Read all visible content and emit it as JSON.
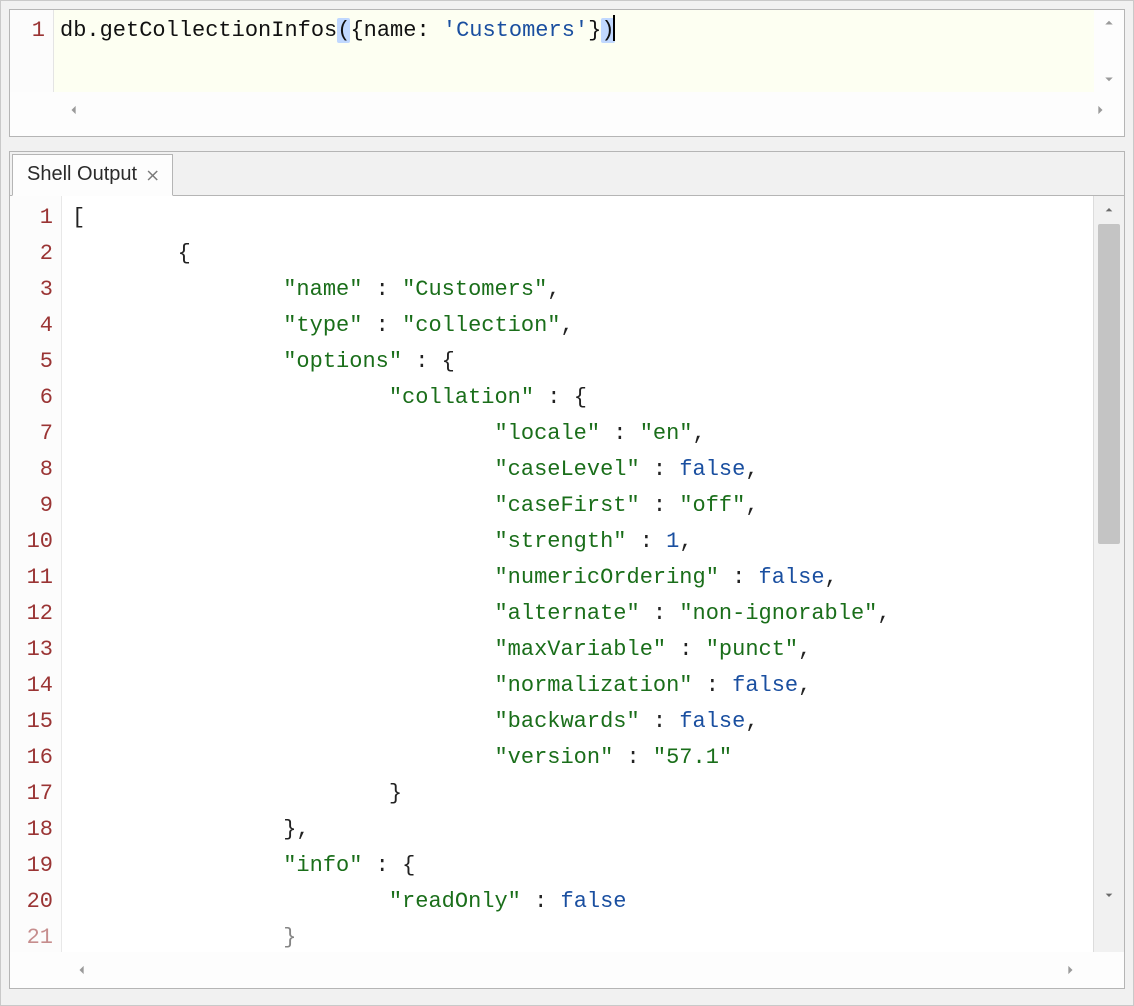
{
  "input": {
    "line_number": "1",
    "tokens": {
      "obj": "db",
      "dot": ".",
      "func": "getCollectionInfos",
      "paren_open": "(",
      "brace_open": "{",
      "key": "name",
      "colon": ": ",
      "str": "'Customers'",
      "brace_close": "}",
      "paren_close": ")"
    }
  },
  "tabs": {
    "shell_output": "Shell Output",
    "close_glyph": "⨯"
  },
  "output": {
    "line_numbers": [
      "1",
      "2",
      "3",
      "4",
      "5",
      "6",
      "7",
      "8",
      "9",
      "10",
      "11",
      "12",
      "13",
      "14",
      "15",
      "16",
      "17",
      "18",
      "19",
      "20",
      "21"
    ],
    "lines": [
      {
        "indent": 0,
        "raw": "[",
        "parts": [
          {
            "t": "[",
            "cls": "j-punc"
          }
        ]
      },
      {
        "indent": 1,
        "raw": "{",
        "parts": [
          {
            "t": "{",
            "cls": "j-punc"
          }
        ]
      },
      {
        "indent": 2,
        "raw": "\"name\" : \"Customers\",",
        "parts": [
          {
            "t": "\"name\"",
            "cls": "j-key"
          },
          {
            "t": " : ",
            "cls": "j-punc"
          },
          {
            "t": "\"Customers\"",
            "cls": "j-str"
          },
          {
            "t": ",",
            "cls": "j-punc"
          }
        ]
      },
      {
        "indent": 2,
        "raw": "\"type\" : \"collection\",",
        "parts": [
          {
            "t": "\"type\"",
            "cls": "j-key"
          },
          {
            "t": " : ",
            "cls": "j-punc"
          },
          {
            "t": "\"collection\"",
            "cls": "j-str"
          },
          {
            "t": ",",
            "cls": "j-punc"
          }
        ]
      },
      {
        "indent": 2,
        "raw": "\"options\" : {",
        "parts": [
          {
            "t": "\"options\"",
            "cls": "j-key"
          },
          {
            "t": " : ",
            "cls": "j-punc"
          },
          {
            "t": "{",
            "cls": "j-punc"
          }
        ]
      },
      {
        "indent": 3,
        "raw": "\"collation\" : {",
        "parts": [
          {
            "t": "\"collation\"",
            "cls": "j-key"
          },
          {
            "t": " : ",
            "cls": "j-punc"
          },
          {
            "t": "{",
            "cls": "j-punc"
          }
        ]
      },
      {
        "indent": 4,
        "raw": "\"locale\" : \"en\",",
        "parts": [
          {
            "t": "\"locale\"",
            "cls": "j-key"
          },
          {
            "t": " : ",
            "cls": "j-punc"
          },
          {
            "t": "\"en\"",
            "cls": "j-str"
          },
          {
            "t": ",",
            "cls": "j-punc"
          }
        ]
      },
      {
        "indent": 4,
        "raw": "\"caseLevel\" : false,",
        "parts": [
          {
            "t": "\"caseLevel\"",
            "cls": "j-key"
          },
          {
            "t": " : ",
            "cls": "j-punc"
          },
          {
            "t": "false",
            "cls": "j-bool"
          },
          {
            "t": ",",
            "cls": "j-punc"
          }
        ]
      },
      {
        "indent": 4,
        "raw": "\"caseFirst\" : \"off\",",
        "parts": [
          {
            "t": "\"caseFirst\"",
            "cls": "j-key"
          },
          {
            "t": " : ",
            "cls": "j-punc"
          },
          {
            "t": "\"off\"",
            "cls": "j-str"
          },
          {
            "t": ",",
            "cls": "j-punc"
          }
        ]
      },
      {
        "indent": 4,
        "raw": "\"strength\" : 1,",
        "parts": [
          {
            "t": "\"strength\"",
            "cls": "j-key"
          },
          {
            "t": " : ",
            "cls": "j-punc"
          },
          {
            "t": "1",
            "cls": "j-num"
          },
          {
            "t": ",",
            "cls": "j-punc"
          }
        ]
      },
      {
        "indent": 4,
        "raw": "\"numericOrdering\" : false,",
        "parts": [
          {
            "t": "\"numericOrdering\"",
            "cls": "j-key"
          },
          {
            "t": " : ",
            "cls": "j-punc"
          },
          {
            "t": "false",
            "cls": "j-bool"
          },
          {
            "t": ",",
            "cls": "j-punc"
          }
        ]
      },
      {
        "indent": 4,
        "raw": "\"alternate\" : \"non-ignorable\",",
        "parts": [
          {
            "t": "\"alternate\"",
            "cls": "j-key"
          },
          {
            "t": " : ",
            "cls": "j-punc"
          },
          {
            "t": "\"non-ignorable\"",
            "cls": "j-str"
          },
          {
            "t": ",",
            "cls": "j-punc"
          }
        ]
      },
      {
        "indent": 4,
        "raw": "\"maxVariable\" : \"punct\",",
        "parts": [
          {
            "t": "\"maxVariable\"",
            "cls": "j-key"
          },
          {
            "t": " : ",
            "cls": "j-punc"
          },
          {
            "t": "\"punct\"",
            "cls": "j-str"
          },
          {
            "t": ",",
            "cls": "j-punc"
          }
        ]
      },
      {
        "indent": 4,
        "raw": "\"normalization\" : false,",
        "parts": [
          {
            "t": "\"normalization\"",
            "cls": "j-key"
          },
          {
            "t": " : ",
            "cls": "j-punc"
          },
          {
            "t": "false",
            "cls": "j-bool"
          },
          {
            "t": ",",
            "cls": "j-punc"
          }
        ]
      },
      {
        "indent": 4,
        "raw": "\"backwards\" : false,",
        "parts": [
          {
            "t": "\"backwards\"",
            "cls": "j-key"
          },
          {
            "t": " : ",
            "cls": "j-punc"
          },
          {
            "t": "false",
            "cls": "j-bool"
          },
          {
            "t": ",",
            "cls": "j-punc"
          }
        ]
      },
      {
        "indent": 4,
        "raw": "\"version\" : \"57.1\"",
        "parts": [
          {
            "t": "\"version\"",
            "cls": "j-key"
          },
          {
            "t": " : ",
            "cls": "j-punc"
          },
          {
            "t": "\"57.1\"",
            "cls": "j-str"
          }
        ]
      },
      {
        "indent": 3,
        "raw": "}",
        "parts": [
          {
            "t": "}",
            "cls": "j-punc"
          }
        ]
      },
      {
        "indent": 2,
        "raw": "},",
        "parts": [
          {
            "t": "},",
            "cls": "j-punc"
          }
        ]
      },
      {
        "indent": 2,
        "raw": "\"info\" : {",
        "parts": [
          {
            "t": "\"info\"",
            "cls": "j-key"
          },
          {
            "t": " : ",
            "cls": "j-punc"
          },
          {
            "t": "{",
            "cls": "j-punc"
          }
        ]
      },
      {
        "indent": 3,
        "raw": "\"readOnly\" : false",
        "parts": [
          {
            "t": "\"readOnly\"",
            "cls": "j-key"
          },
          {
            "t": " : ",
            "cls": "j-punc"
          },
          {
            "t": "false",
            "cls": "j-bool"
          }
        ]
      },
      {
        "indent": 2,
        "raw": "}",
        "parts": [
          {
            "t": "}",
            "cls": "j-punc"
          }
        ],
        "partial": true
      }
    ],
    "indent_unit": "        "
  }
}
